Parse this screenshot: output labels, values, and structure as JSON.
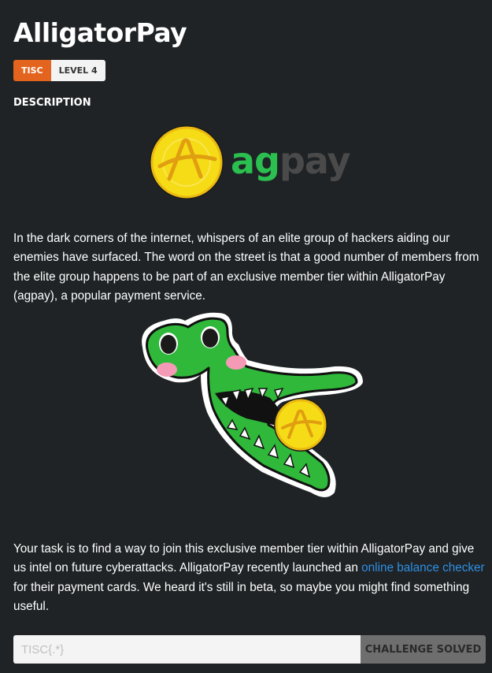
{
  "challenge": {
    "title": "AlligatorPay",
    "category": "TISC",
    "level": "LEVEL 4"
  },
  "description": {
    "heading": "DESCRIPTION",
    "logo_text": "agpay",
    "logo_text_ag": "ag",
    "logo_text_pay": "pay",
    "paragraph1": "In the dark corners of the internet, whispers of an elite group of hackers aiding our enemies have surfaced. The word on the street is that a good number of members from the elite group happens to be part of an exclusive member tier within AlligatorPay (agpay), a popular payment service.",
    "paragraph2_before": "Your task is to find a way to join this exclusive member tier within AlligatorPay and give us intel on future cyberattacks. AlligatorPay recently launched an ",
    "paragraph2_link": "online balance checker",
    "paragraph2_after": " for their payment cards. We heard it's still in beta, so maybe you might find something useful."
  },
  "flag_form": {
    "placeholder": "TISC{.*}",
    "value": "",
    "submit_label": "CHALLENGE SOLVED"
  },
  "colors": {
    "background": "#1f2326",
    "category_tag": "#e3641e",
    "level_tag": "#f3f3f3",
    "link": "#2e8fe3",
    "logo_green": "#2bbf4f",
    "logo_gray": "#4a4a4a",
    "coin_yellow": "#f6dc17",
    "gator_green": "#2fb83a",
    "submit_button": "#6e6e6e"
  },
  "icons": {
    "logo_coin": "coin-a-icon",
    "illustration": "alligator-holding-coin"
  }
}
